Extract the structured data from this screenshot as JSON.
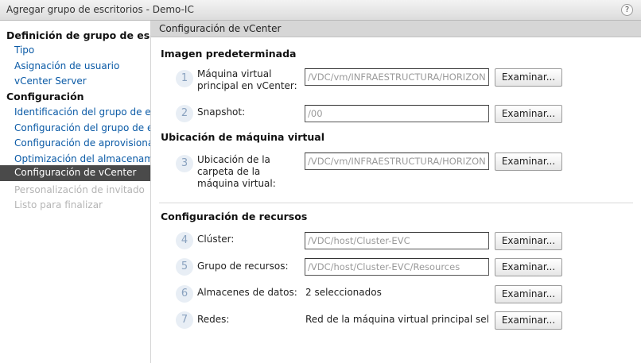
{
  "window": {
    "title": "Agregar grupo de escritorios - Demo-IC",
    "help": "?"
  },
  "sidebar": {
    "section1": "Definición de grupo de escrit",
    "section1_items": [
      "Tipo",
      "Asignación de usuario",
      "vCenter Server"
    ],
    "section2": "Configuración",
    "section2_items": [
      "Identificación del grupo de esc",
      "Configuración del grupo de esc",
      "Configuración de aprovisionam",
      "Optimización del almacenamie",
      "Configuración de vCenter",
      "Personalización de invitado",
      "Listo para finalizar"
    ],
    "active_index": 4
  },
  "content": {
    "header": "Configuración de vCenter",
    "sections": {
      "default_image": "Imagen predeterminada",
      "vm_location": "Ubicación de máquina virtual",
      "resources": "Configuración de recursos"
    },
    "fields": [
      {
        "num": "1",
        "label": "Máquina virtual principal en vCenter:",
        "value": "/VDC/vm/INFRAESTRUCTURA/HORIZON",
        "button": "Examinar..."
      },
      {
        "num": "2",
        "label": "Snapshot:",
        "value": "/00",
        "button": "Examinar..."
      },
      {
        "num": "3",
        "label": "Ubicación de la carpeta de la máquina virtual:",
        "value": "/VDC/vm/INFRAESTRUCTURA/HORIZON",
        "button": "Examinar..."
      },
      {
        "num": "4",
        "label": "Clúster:",
        "value": "/VDC/host/Cluster-EVC",
        "button": "Examinar..."
      },
      {
        "num": "5",
        "label": "Grupo de recursos:",
        "value": "/VDC/host/Cluster-EVC/Resources",
        "button": "Examinar..."
      },
      {
        "num": "6",
        "label": "Almacenes de datos:",
        "value": "2 seleccionados",
        "button": "Examinar..."
      },
      {
        "num": "7",
        "label": "Redes:",
        "value": "Red de la máquina virtual principal sel...",
        "button": "Examinar..."
      }
    ]
  },
  "colors": {
    "nav_link": "#0a5aa6",
    "active_bg": "#4a4a4a",
    "step_bg": "#e8eef5",
    "step_fg": "#8aa2bf"
  }
}
